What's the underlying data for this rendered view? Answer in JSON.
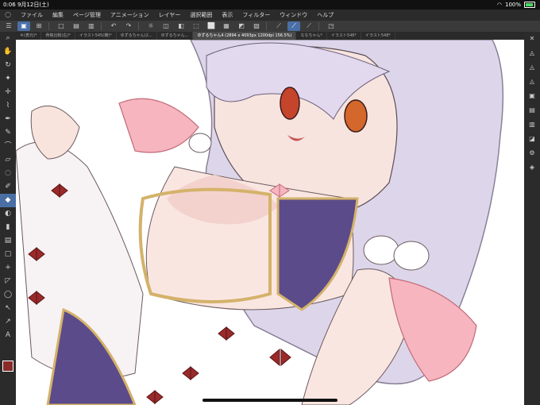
{
  "status": {
    "time": "0:06",
    "date": "9月12日(土)",
    "battery": "100%"
  },
  "menu": {
    "items": [
      "ファイル",
      "編集",
      "ページ管理",
      "アニメーション",
      "レイヤー",
      "選択範囲",
      "表示",
      "フィルター",
      "ウィンドウ",
      "ヘルプ"
    ]
  },
  "tabs": [
    "キ(表元)*",
    "骨格比較(右)*",
    "イラスト545(横)*",
    "ゆずるちゃん(2...",
    "ゆずるちゃん...",
    "ゆずるちゃん4 (2894 x 4093px 1200dpi 156.5%)",
    "ななちゃん*",
    "イラスト546*",
    "イラスト548*"
  ],
  "colors": {
    "canvas": "#ffffff",
    "accent": "#4a6fa5",
    "main_color": "#8a2a2a"
  },
  "left_tools": [
    "zoom-icon",
    "hand-icon",
    "rotate-icon",
    "magic-wand-icon",
    "move-icon",
    "eyedropper-icon",
    "pen-icon",
    "pencil-icon",
    "brush-icon",
    "eraser-icon",
    "lasso-icon",
    "gradient-icon",
    "fill-icon",
    "blend-icon",
    "selection-icon",
    "figure-icon",
    "ruler-icon",
    "operation-icon",
    "text-icon",
    "balloon-icon"
  ],
  "right_tools": [
    "close-icon",
    "layer-icon",
    "layer-2-icon",
    "layer-3-icon",
    "save-icon",
    "export-icon",
    "export-2-icon",
    "undo-history-icon",
    "gear-icon",
    "layers-icon"
  ]
}
